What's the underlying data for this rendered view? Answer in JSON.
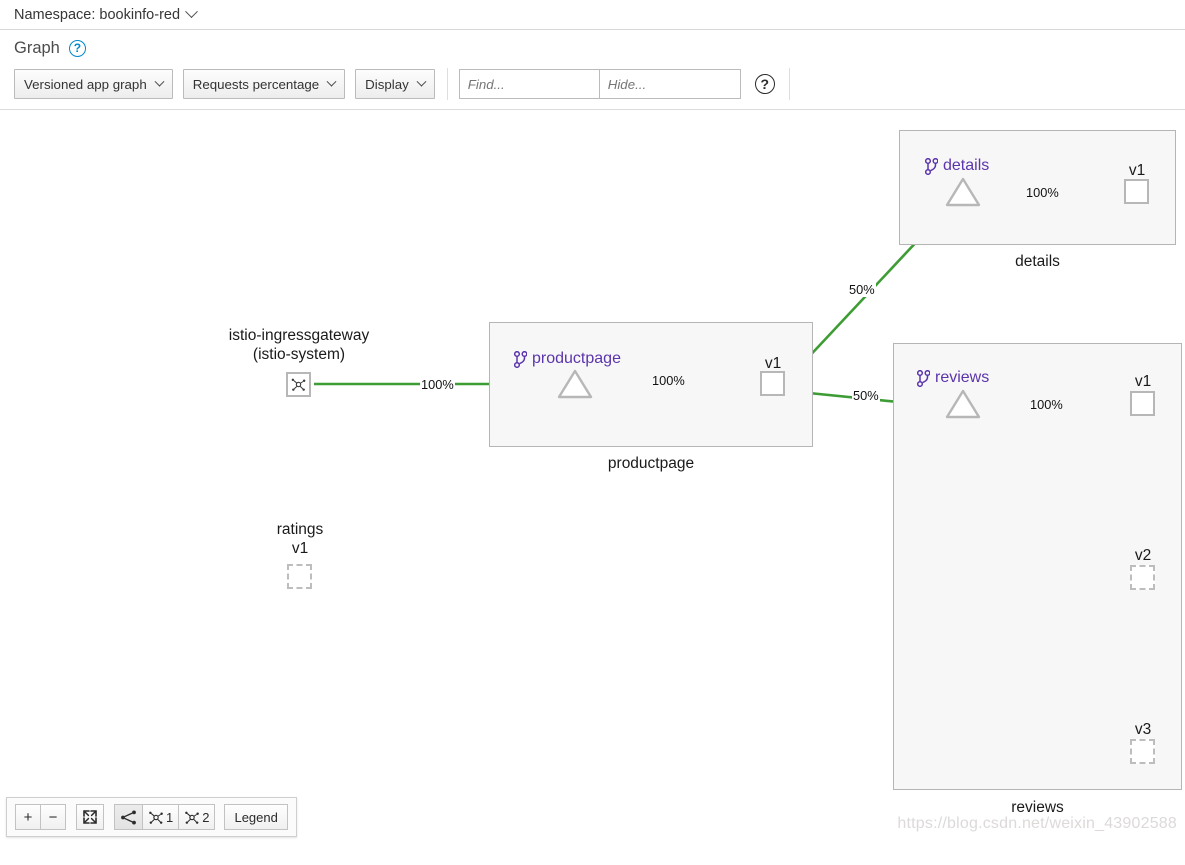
{
  "namespace_bar": {
    "label": "Namespace: bookinfo-red",
    "caret_icon": "chevron-down-icon"
  },
  "header": {
    "title": "Graph",
    "help_icon": "question-circle-icon"
  },
  "toolbar": {
    "graph_type": "Versioned app graph",
    "edge_labels": "Requests percentage",
    "display": "Display",
    "find": {
      "value": "",
      "placeholder": "Find..."
    },
    "hide": {
      "value": "",
      "placeholder": "Hide..."
    },
    "help_icon": "question-circle-icon"
  },
  "graph": {
    "nodes": [
      {
        "id": "istio-ingressgateway",
        "label_line1": "istio-ingressgateway",
        "label_line2": "(istio-system)",
        "shape": "square",
        "icon": "topology-icon",
        "state": "active"
      },
      {
        "id": "ratings",
        "label_line1": "ratings",
        "label_line2": "v1",
        "shape": "square",
        "state": "idle"
      },
      {
        "id": "productpage-service",
        "shape": "triangle",
        "state": "active"
      },
      {
        "id": "productpage-v1",
        "label": "v1",
        "shape": "square",
        "state": "active"
      },
      {
        "id": "details-service",
        "shape": "triangle",
        "state": "active"
      },
      {
        "id": "details-v1",
        "label": "v1",
        "shape": "square",
        "state": "active"
      },
      {
        "id": "reviews-service",
        "shape": "triangle",
        "state": "active"
      },
      {
        "id": "reviews-v1",
        "label": "v1",
        "shape": "square",
        "state": "active"
      },
      {
        "id": "reviews-v2",
        "label": "v2",
        "shape": "square",
        "state": "idle"
      },
      {
        "id": "reviews-v3",
        "label": "v3",
        "shape": "square",
        "state": "idle"
      }
    ],
    "groups": [
      {
        "id": "productpage",
        "app_label": "productpage",
        "box_label": "productpage",
        "app_icon": "code-branch-icon"
      },
      {
        "id": "details",
        "app_label": "details",
        "box_label": "details",
        "app_icon": "code-branch-icon"
      },
      {
        "id": "reviews",
        "app_label": "reviews",
        "box_label": "reviews",
        "app_icon": "code-branch-icon"
      }
    ],
    "edges": [
      {
        "id": "ingress-to-productpage",
        "label": "100%"
      },
      {
        "id": "productpage-svc-to-v1",
        "label": "100%"
      },
      {
        "id": "productpage-to-details",
        "label": "50%"
      },
      {
        "id": "productpage-to-reviews",
        "label": "50%"
      },
      {
        "id": "details-svc-to-v1",
        "label": "100%"
      },
      {
        "id": "reviews-svc-to-v1",
        "label": "100%"
      }
    ],
    "colors": {
      "edge_healthy": "#3e9c35",
      "app_label": "#5b35ab",
      "node_border": "#b7b7b7",
      "group_border": "#b5b5b5",
      "group_fill": "#f7f7f7"
    }
  },
  "cy_toolbar": {
    "zoom_in": "+",
    "zoom_out": "−",
    "fit_icon": "expand-icon",
    "topology_icon": "share-topology-icon",
    "service_nodes_1": "1",
    "service_nodes_2": "2",
    "legend": "Legend"
  },
  "watermark": "https://blog.csdn.net/weixin_43902588"
}
